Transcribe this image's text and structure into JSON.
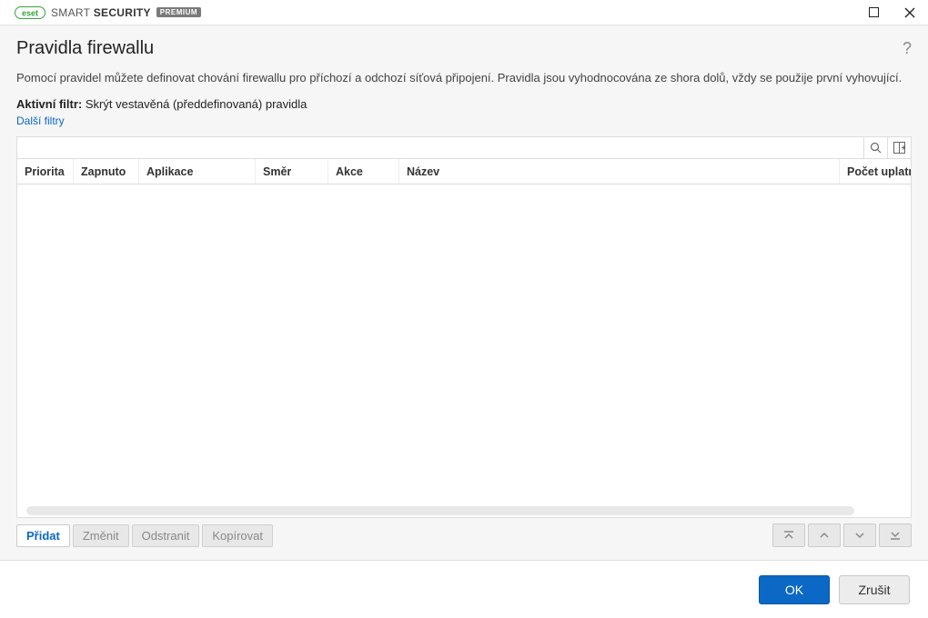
{
  "titlebar": {
    "brand_light": "SMART",
    "brand_bold": "SECURITY",
    "badge": "PREMIUM"
  },
  "header": {
    "title": "Pravidla firewallu"
  },
  "description": "Pomocí pravidel můžete definovat chování firewallu pro příchozí a odchozí síťová připojení. Pravidla jsou vyhodnocována ze shora dolů, vždy se použije první vyhovující.",
  "filter": {
    "label": "Aktivní filtr:",
    "value": "Skrýt vestavěná (předdefinovaná) pravidla",
    "more": "Další filtry"
  },
  "search": {
    "value": "",
    "placeholder": ""
  },
  "columns": {
    "priorita": "Priorita",
    "zapnuto": "Zapnuto",
    "aplikace": "Aplikace",
    "smer": "Směr",
    "akce": "Akce",
    "nazev": "Název",
    "pocet": "Počet uplatně"
  },
  "rows": [],
  "actions": {
    "add": "Přidat",
    "edit": "Změnit",
    "remove": "Odstranit",
    "copy": "Kopírovat"
  },
  "dialog": {
    "ok": "OK",
    "cancel": "Zrušit"
  }
}
